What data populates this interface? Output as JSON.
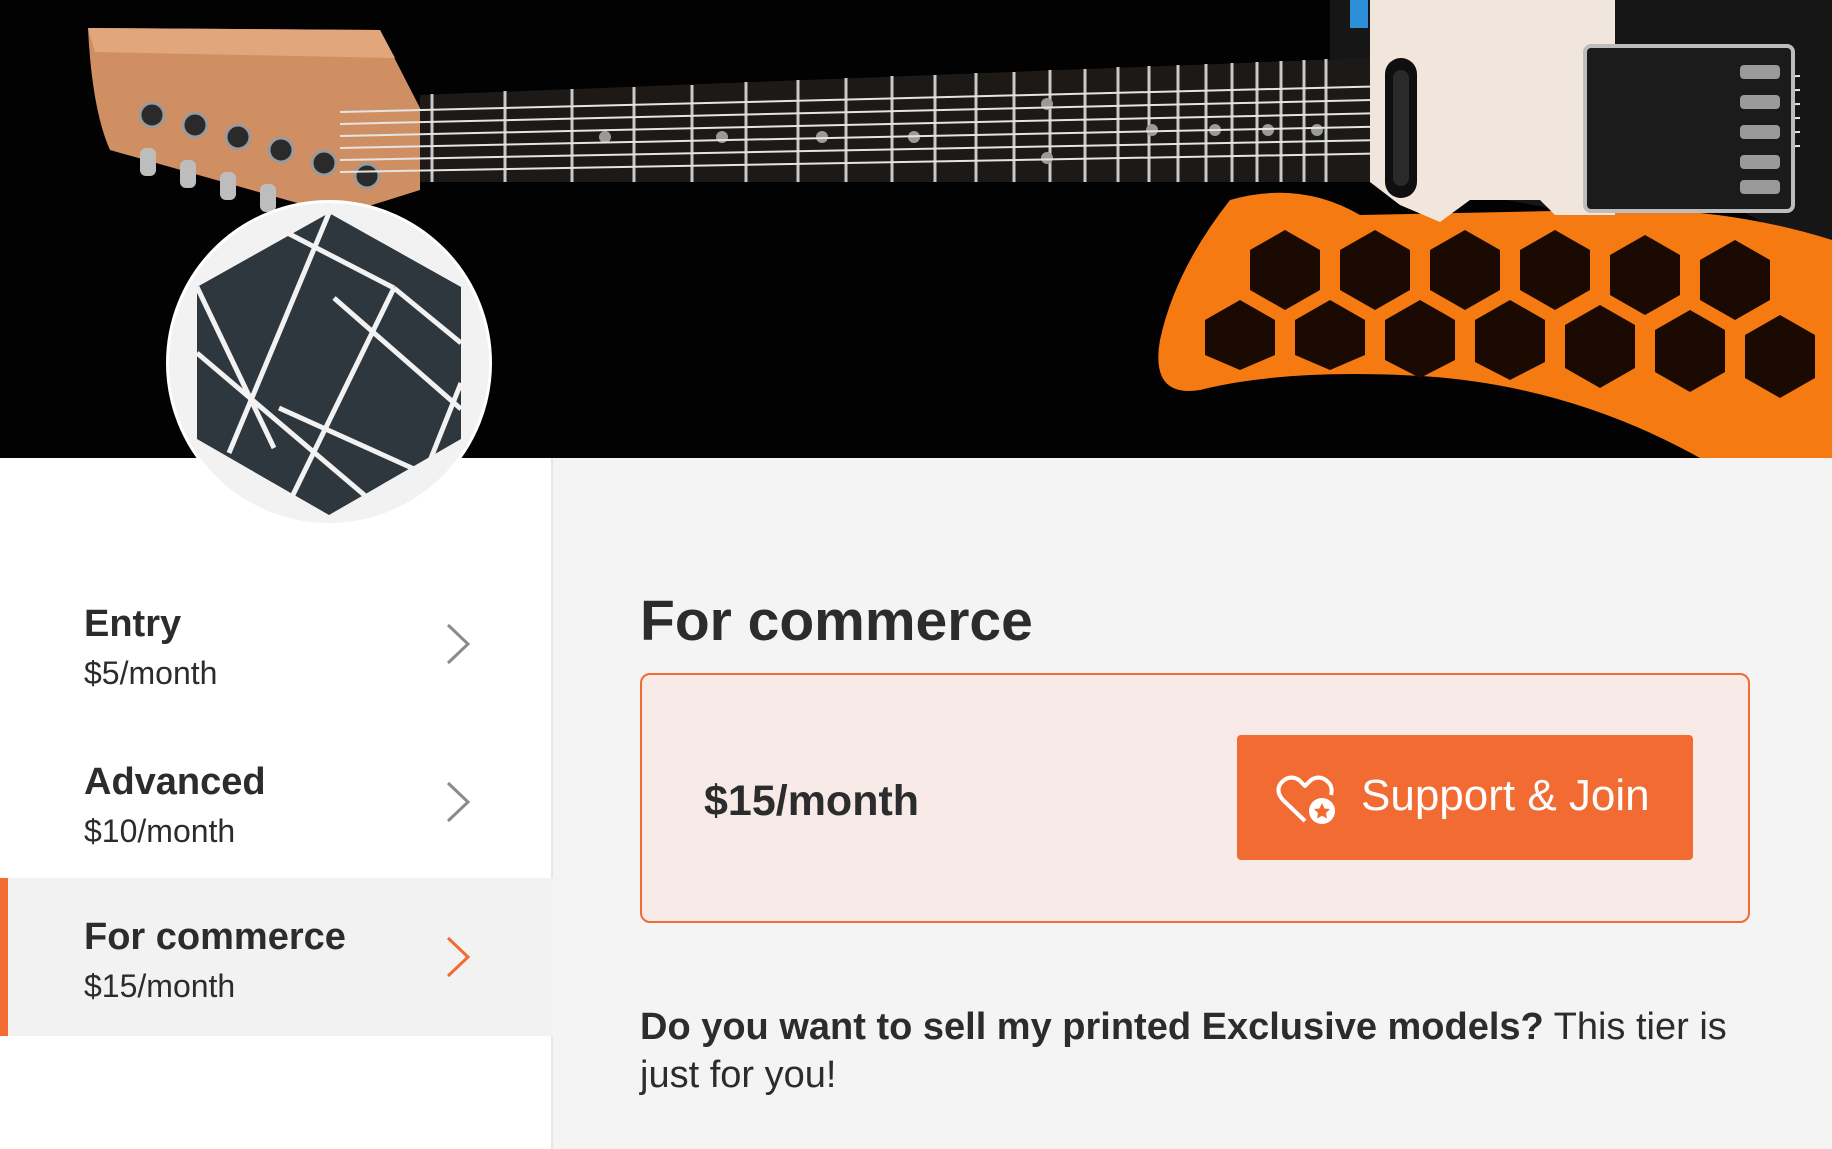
{
  "banner": {
    "image_description_icon": "guitar-banner-image"
  },
  "avatar": {
    "icon": "hexagon-logo-icon"
  },
  "sidebar": {
    "tiers": [
      {
        "name": "Entry",
        "price": "$5/month"
      },
      {
        "name": "Advanced",
        "price": "$10/month"
      },
      {
        "name": "For commerce",
        "price": "$15/month"
      }
    ],
    "active_index": 2
  },
  "main": {
    "title": "For commerce",
    "card": {
      "price": "$15/month",
      "button_label": "Support & Join",
      "button_icon": "heart-star-icon"
    },
    "description_bold": "Do you want to sell my printed Exclusive models?",
    "description_rest": "This tier is just for you!"
  },
  "colors": {
    "accent": "#f26b33",
    "card_bg": "#f8ebe7",
    "panel_bg": "#f4f4f4",
    "text": "#2b2c2e"
  }
}
